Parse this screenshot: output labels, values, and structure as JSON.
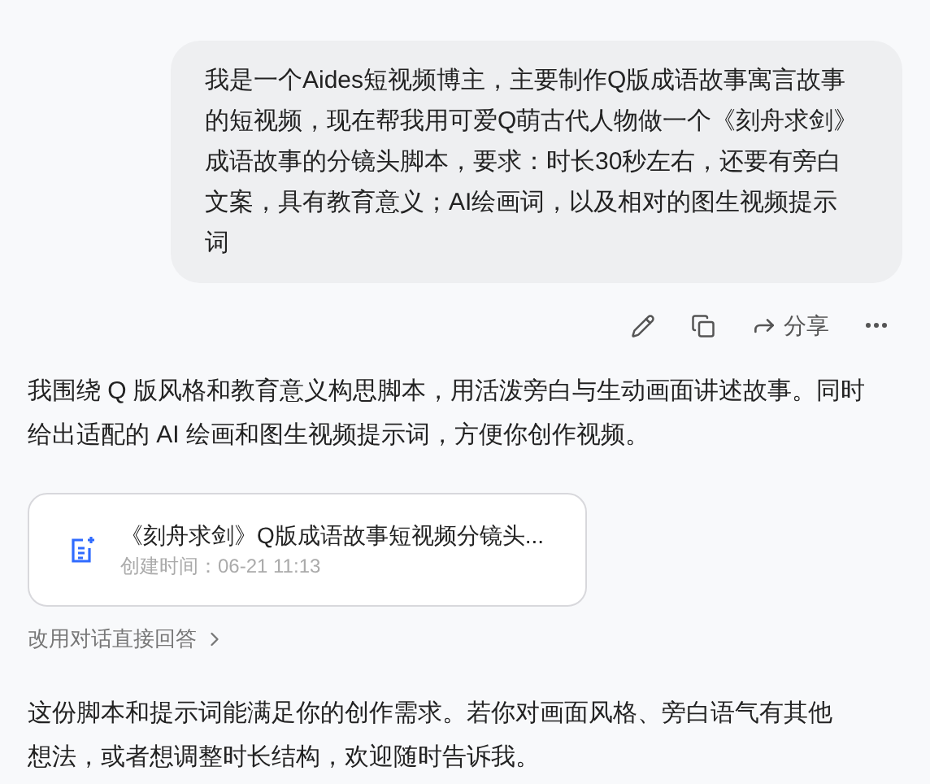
{
  "user_message": {
    "text": "我是一个Aides短视频博主，主要制作Q版成语故事寓言故事的短视频，现在帮我用可爱Q萌古代人物做一个《刻舟求剑》成语故事的分镜头脚本，要求：时长30秒左右，还要有旁白文案，具有教育意义；AI绘画词，以及相对的图生视频提示词"
  },
  "message_actions": [
    {
      "kind": "edit"
    },
    {
      "kind": "copy"
    },
    {
      "kind": "share",
      "label": "分享"
    },
    {
      "kind": "more"
    }
  ],
  "reply": {
    "intro": "我围绕 Q 版风格和教育意义构思脚本，用活泼旁白与生动画面讲述故事。同时给出适配的 AI 绘画和图生视频提示词，方便你创作视频。",
    "document_card": {
      "title": "《刻舟求剑》Q版成语故事短视频分镜头...",
      "created": "创建时间：06-21 11:13"
    },
    "switch_link": "改用对话直接回答",
    "closing": "这份脚本和提示词能满足你的创作需求。若你对画面风格、旁白语气有其他想法，或者想调整时长结构，欢迎随时告诉我。"
  }
}
